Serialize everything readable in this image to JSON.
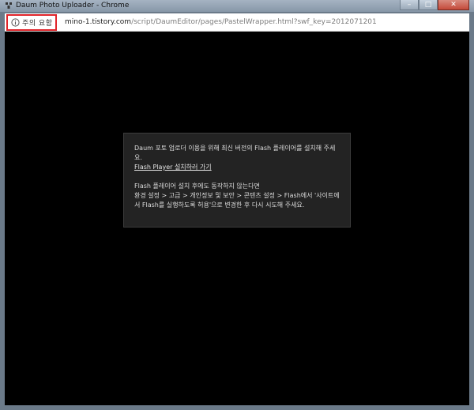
{
  "window": {
    "title": "Daum Photo Uploader - Chrome",
    "app_icon": "uploader-icon",
    "controls": {
      "minimize": "–",
      "maximize": "□",
      "close": "✕"
    }
  },
  "addressbar": {
    "security_badge": {
      "icon": "info-icon",
      "label": "주의 요함",
      "border_color": "#e0242a"
    },
    "url_host": "mino-1.tistory.com",
    "url_path": "/script/DaumEditor/pages/PastelWrapper.html?swf_key=2012071201"
  },
  "notice": {
    "line1": "Daum 포토 업로더 이용을 위해 최신 버전의 Flash 플레이어를 설치해 주세요.",
    "link": "Flash Player 설치하러 가기",
    "line2": "Flash 플레이어 설치 후에도 동작하지 않는다면",
    "line3": "환경 설정 > 고급 > 개인정보 및 보안 > 콘텐츠 설정 > Flash에서 '사이트에서 Flash를 실행하도록 허용'으로 변경한 후 다시 시도해 주세요."
  }
}
